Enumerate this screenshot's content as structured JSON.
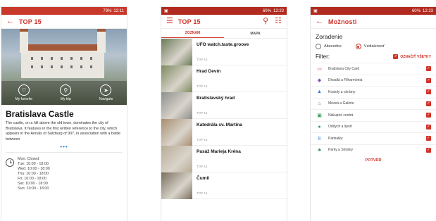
{
  "screen1": {
    "status_time": "12:11",
    "status_battery": "79%",
    "title": "TOP 15",
    "hero_actions": [
      "My favorite",
      "My trip",
      "Navigate"
    ],
    "place_title": "Bratislava Castle",
    "description": "The castle, on a hill above the old town, dominates the city of Bratislava. It features in the first written reference to the city, which appears in the Annals of Salzburg of 907, in association with a battle between",
    "more": "•••",
    "hours": [
      "Mon: Closed",
      "Tue: 10:00 - 18:00",
      "Wed: 10:00 - 18:00",
      "Thu: 10:00 - 18:00",
      "Fri: 10:00 - 18:00",
      "Sat: 10:00 - 18:00",
      "Sun: 10:00 - 18:00"
    ]
  },
  "screen2": {
    "status_time": "12:23",
    "status_battery": "60%",
    "title": "TOP 15",
    "tabs": [
      "ZOZNAM",
      "MAPA"
    ],
    "items": [
      {
        "title": "UFO watch.taste.groove",
        "sub": "TOP 15",
        "color": "#6b7b58"
      },
      {
        "title": "Hrad Devín",
        "sub": "TOP 15",
        "color": "#7d8a5f"
      },
      {
        "title": "Bratislavský hrad",
        "sub": "TOP 15",
        "color": "#8e8f8c"
      },
      {
        "title": "Katedrála sv. Martina",
        "sub": "TOP 15",
        "color": "#a88e6f"
      },
      {
        "title": "Pasáž Marieja Kréna",
        "sub": "TOP 15",
        "color": "#b9ab96"
      },
      {
        "title": "Čumil",
        "sub": "TOP 15",
        "color": "#7a6f5e"
      }
    ]
  },
  "screen3": {
    "status_time": "12:23",
    "status_battery": "60%",
    "title": "Možnosti",
    "sort_title": "Zoradenie",
    "sort_options": [
      "Abecedne",
      "Vzdialenosť"
    ],
    "filter_title": "Filter:",
    "mark_all": "OZNAČIŤ VŠETKY",
    "filters": [
      {
        "label": "Bratislava City Card",
        "icon": "▭",
        "color": "#d0332a"
      },
      {
        "label": "Divadlá a Filharmónia",
        "icon": "◆",
        "color": "#8a4fbf"
      },
      {
        "label": "Kostoly a chrámy",
        "icon": "▲",
        "color": "#2d7bd6"
      },
      {
        "label": "Múzeá a Galérie",
        "icon": "⌂",
        "color": "#a33a8a"
      },
      {
        "label": "Nákupné centrá",
        "icon": "▣",
        "color": "#2e9a52"
      },
      {
        "label": "Oddych a šport",
        "icon": "●",
        "color": "#2e9a52"
      },
      {
        "label": "Pamiatky",
        "icon": "Ⅱ",
        "color": "#2d7bd6"
      },
      {
        "label": "Parky a Sintány",
        "icon": "♣",
        "color": "#2e9a52"
      }
    ],
    "confirm": "POTVRĎ"
  }
}
